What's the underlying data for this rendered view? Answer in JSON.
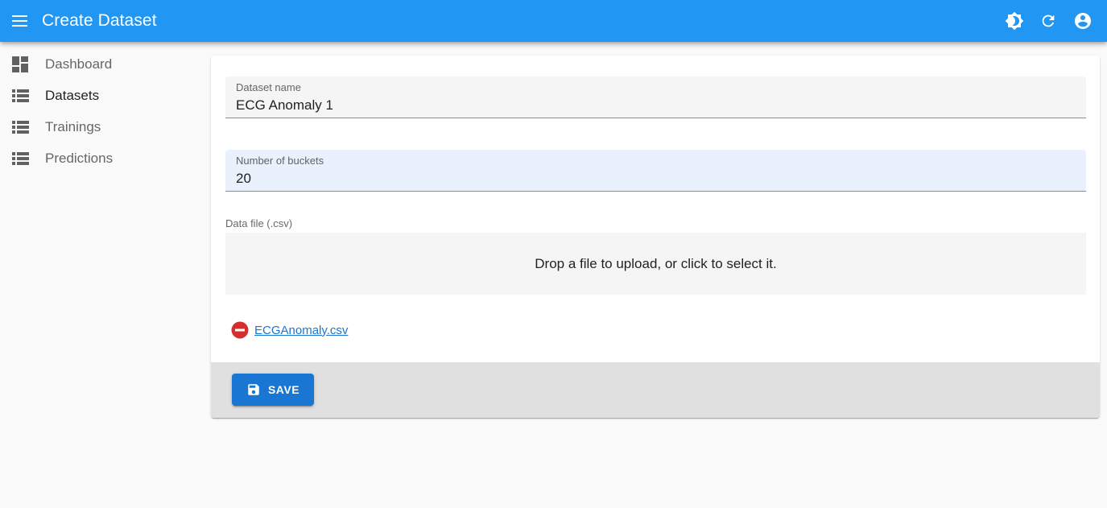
{
  "app_bar": {
    "title": "Create Dataset",
    "menu_icon": "menu-icon",
    "actions": [
      "theme-toggle-icon",
      "refresh-icon",
      "account-icon"
    ],
    "color": "#2196f3"
  },
  "sidebar": {
    "items": [
      {
        "label": "Dashboard",
        "icon": "dashboard-icon",
        "active": false
      },
      {
        "label": "Datasets",
        "icon": "list-icon",
        "active": true
      },
      {
        "label": "Trainings",
        "icon": "list-icon",
        "active": false
      },
      {
        "label": "Predictions",
        "icon": "list-icon",
        "active": false
      }
    ]
  },
  "form": {
    "dataset_name": {
      "label": "Dataset name",
      "value": "ECG Anomaly 1"
    },
    "buckets": {
      "label": "Number of buckets",
      "value": "20"
    },
    "data_file": {
      "label": "Data file (.csv)",
      "dropzone_text": "Drop a file to upload, or click to select it.",
      "file_name": "ECGAnomaly.csv"
    }
  },
  "toolbar": {
    "save_label": "SAVE",
    "save_color": "#1976d2"
  }
}
